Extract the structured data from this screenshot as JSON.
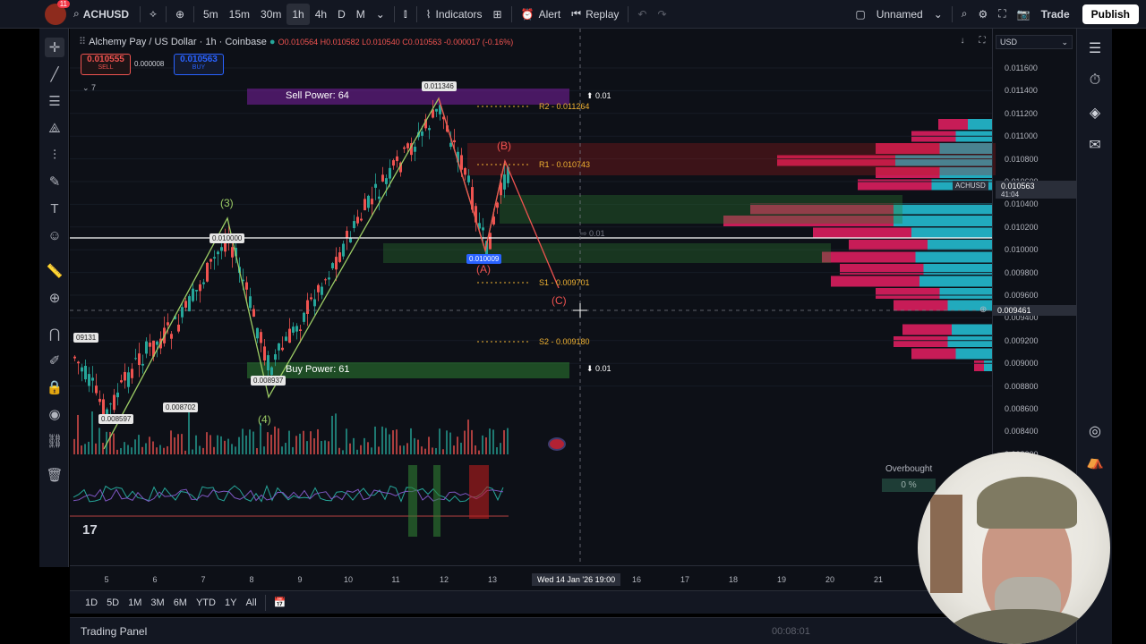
{
  "topbar": {
    "avatar_badge": "11",
    "symbol": "ACHUSD",
    "intervals": [
      "5m",
      "15m",
      "30m",
      "1h",
      "4h",
      "D",
      "M"
    ],
    "active_interval": "1h",
    "indicators": "Indicators",
    "alert": "Alert",
    "replay": "Replay",
    "layout_name": "Unnamed",
    "trade": "Trade",
    "publish": "Publish"
  },
  "legend": {
    "title": "Alchemy Pay / US Dollar · 1h · Coinbase",
    "ohlc": "O0.010564  H0.010582  L0.010540  C0.010563  -0.000017 (-0.16%)",
    "sell_price": "0.010555",
    "sell_label": "SELL",
    "spread": "0.000008",
    "buy_price": "0.010563",
    "buy_label": "BUY",
    "indicator_count": "7",
    "currency": "USD"
  },
  "price_axis": {
    "ticks": [
      "0.011600",
      "0.011400",
      "0.011200",
      "0.011000",
      "0.010800",
      "0.010600",
      "0.010400",
      "0.010200",
      "0.010000",
      "0.009800",
      "0.009600",
      "0.009400",
      "0.009200",
      "0.009000",
      "0.008800",
      "0.008600",
      "0.008400",
      "0.008200"
    ],
    "current_symbol": "ACHUSD",
    "current_price": "0.010563",
    "countdown": "41:04",
    "crosshair_price": "0.009461"
  },
  "time_axis": {
    "ticks": [
      "5",
      "6",
      "7",
      "8",
      "9",
      "10",
      "11",
      "12",
      "13",
      "16",
      "17",
      "18",
      "19",
      "20",
      "21"
    ],
    "crosshair_time": "Wed 14 Jan '26   19:00"
  },
  "annotations": {
    "sell_power": "Sell Power: 64",
    "buy_power": "Buy Power: 61",
    "r2": "R2 - 0.011264",
    "r1": "R1 - 0.010743",
    "s1": "S1 - 0.009701",
    "s2": "S2 - 0.009180",
    "up_size": "0.01",
    "down_size": "0.01",
    "mid_size": "0.01",
    "wave3": "(3)",
    "wave4": "(4)",
    "waveA": "(A)",
    "waveB": "(B)",
    "waveC": "(C)",
    "high_label": "0.011346",
    "level_label": "0.010000",
    "low_mark_label": "0.010009",
    "left_label": "09131",
    "low1_label": "0.008597",
    "low2_label": "0.008702",
    "low3_label": "0.008937"
  },
  "indicator_pane": {
    "overbought_label": "Overbought",
    "overbought_value": "0 %"
  },
  "bottombar": {
    "ranges": [
      "1D",
      "5D",
      "1M",
      "3M",
      "6M",
      "YTD",
      "1Y",
      "All"
    ],
    "timer": "00:08:01"
  },
  "panel": {
    "trading_panel": "Trading Panel"
  },
  "colors": {
    "bg": "#0d1017",
    "up": "#26a69a",
    "down": "#ef5350",
    "wave": "#9ccc65",
    "profile_pink": "#e91e63",
    "profile_teal": "#26c6da",
    "accent": "#2962ff"
  }
}
